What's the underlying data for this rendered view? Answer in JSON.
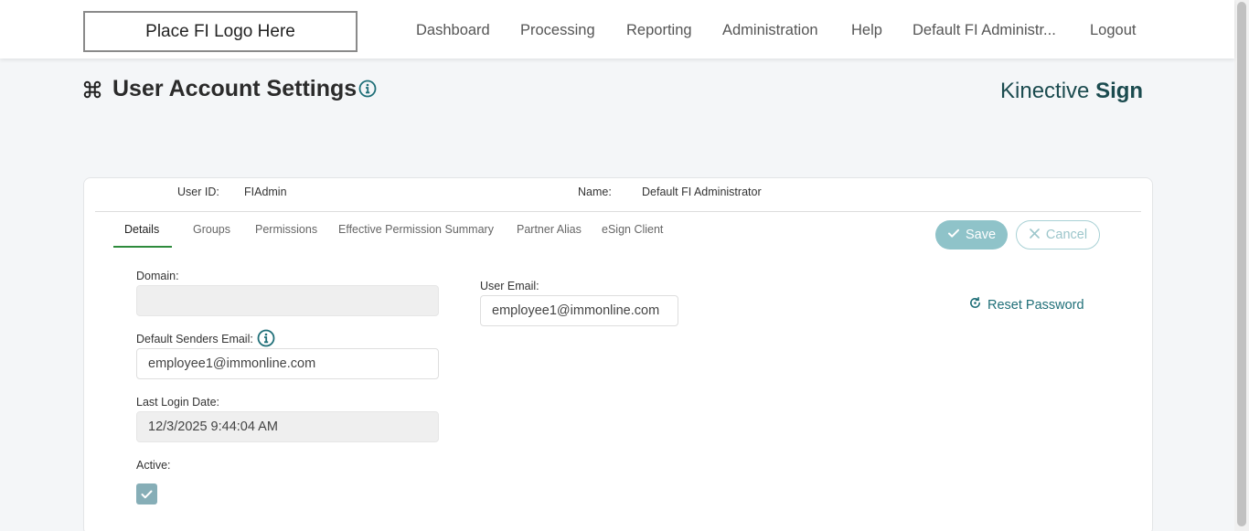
{
  "header": {
    "logo_text": "Place FI Logo Here",
    "nav": {
      "dashboard": "Dashboard",
      "processing": "Processing",
      "reporting": "Reporting",
      "administration": "Administration",
      "help": "Help",
      "user": "Default FI Administr...",
      "logout": "Logout"
    }
  },
  "page": {
    "title": "User Account Settings",
    "brand_light": "Kinective",
    "brand_bold": "Sign"
  },
  "summary": {
    "user_id_label": "User ID:",
    "user_id": "FIAdmin",
    "name_label": "Name:",
    "name": "Default FI Administrator"
  },
  "tabs": {
    "details": "Details",
    "groups": "Groups",
    "permissions": "Permissions",
    "effective": "Effective Permission Summary",
    "partner_alias": "Partner Alias",
    "esign_client": "eSign Client"
  },
  "actions": {
    "save": "Save",
    "cancel": "Cancel",
    "reset_password": "Reset Password"
  },
  "form": {
    "domain_label": "Domain:",
    "domain_value": "",
    "senders_email_label": "Default Senders Email:",
    "senders_email_value": "employee1@immonline.com",
    "last_login_label": "Last Login Date:",
    "last_login_value": "12/3/2025 9:44:04 AM",
    "active_label": "Active:",
    "active": true,
    "user_email_label": "User Email:",
    "user_email_value": "employee1@immonline.com"
  },
  "colors": {
    "accent": "#1f6f78",
    "tab_active": "#2e8b3c",
    "save_bg": "#8fc3c9",
    "checkbox": "#86aeb7"
  }
}
